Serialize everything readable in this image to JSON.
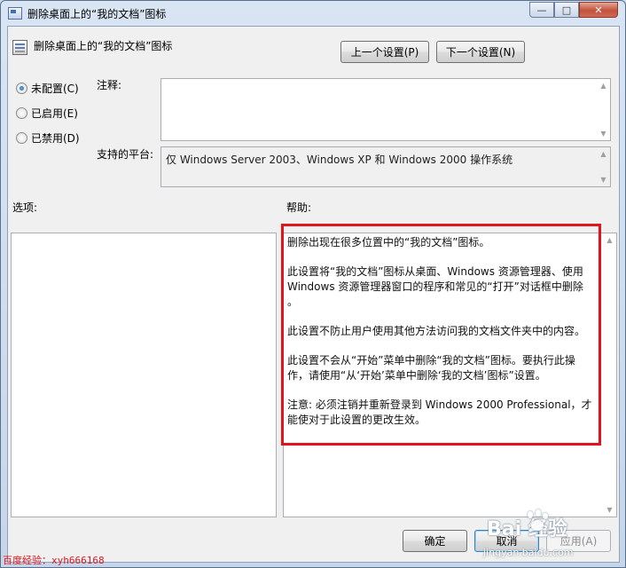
{
  "window": {
    "title": "删除桌面上的“我的文档”图标",
    "caption_minimize": "—",
    "caption_maximize": "□",
    "caption_close": "✕"
  },
  "header": {
    "policy_title": "删除桌面上的“我的文档”图标",
    "prev_button": "上一个设置(P)",
    "next_button": "下一个设置(N)"
  },
  "state": {
    "options": [
      {
        "label": "未配置(C)",
        "checked": true
      },
      {
        "label": "已启用(E)",
        "checked": false
      },
      {
        "label": "已禁用(D)",
        "checked": false
      }
    ]
  },
  "comment": {
    "label": "注释:",
    "value": ""
  },
  "platform": {
    "label": "支持的平台:",
    "value": "仅 Windows Server 2003、Windows XP 和 Windows 2000 操作系统"
  },
  "options_section": {
    "label": "选项:"
  },
  "help_section": {
    "label": "帮助:",
    "lines": [
      [
        "删除出现在很多位置中的“我的文档”图标。"
      ],
      [
        "此设置将“我的文档”图标从桌面、Windows 资源管理器、使用",
        "Windows 资源管理器窗口的程序和常见的“打开”对话框中删除",
        "。"
      ],
      [
        "此设置不防止用户使用其他方法访问我的文档文件夹中的内容。"
      ],
      [
        "此设置不会从“开始”菜单中删除“我的文档”图标。要执行此操",
        "作，请使用“从‘开始’菜单中删除‘我的文档’图标”设置。"
      ],
      [
        "注意: 必须注销并重新登录到 Windows 2000 Professional，才",
        "能使对于此设置的更改生效。"
      ]
    ]
  },
  "footer": {
    "ok_button": "确定",
    "cancel_button": "取消",
    "apply_button": "应用(A)"
  },
  "watermark": {
    "left_text": "百度经验：xyh666168",
    "logo_text": "Bai  经验",
    "sub_text": "jingyan.baidu.com"
  },
  "colors": {
    "highlight": "#e0151b",
    "focus": "#3c7fb1"
  }
}
